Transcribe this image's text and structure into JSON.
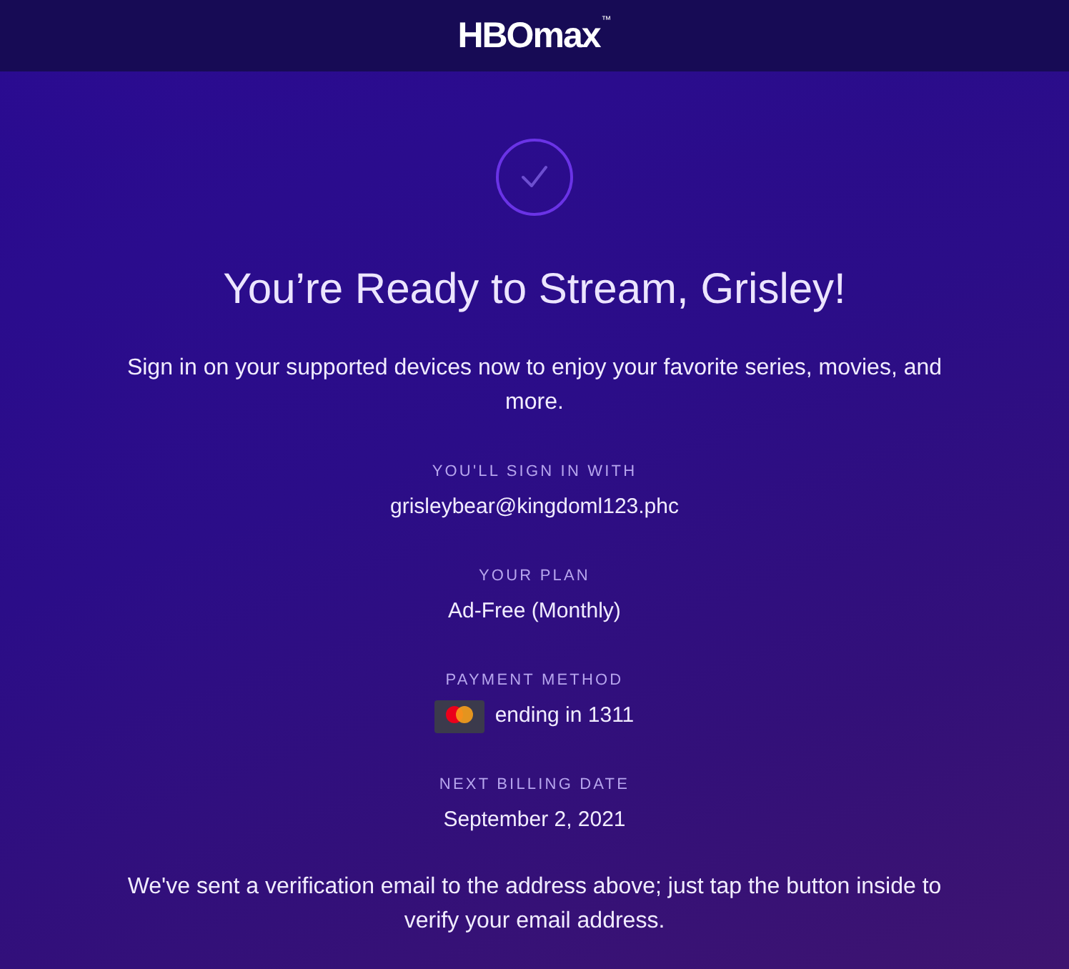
{
  "header": {
    "logo": "HBOmax",
    "trademark": "™"
  },
  "title": "You’re Ready to Stream, Grisley!",
  "intro": "Sign in on your supported devices now to enjoy your favorite series, movies, and more.",
  "details": [
    {
      "kind": "text",
      "label": "YOU'LL SIGN IN WITH",
      "value": "grisleybear@kingdoml123.phc"
    },
    {
      "kind": "text",
      "label": "YOUR PLAN",
      "value": "Ad-Free (Monthly)"
    },
    {
      "kind": "card",
      "label": "PAYMENT METHOD",
      "value": "ending in 1311"
    },
    {
      "kind": "text",
      "label": "NEXT BILLING DATE",
      "value": "September 2, 2021"
    }
  ],
  "note": "We've sent a verification email to the address above; just tap the button inside to verify your email address."
}
